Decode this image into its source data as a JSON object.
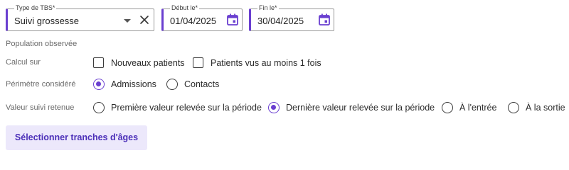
{
  "filters": {
    "type_tbs": {
      "label": "Type de TBS",
      "required_mark": "*",
      "value": "Suivi grossesse"
    },
    "debut": {
      "label": "Début le",
      "required_mark": "*",
      "value": "01/04/2025"
    },
    "fin": {
      "label": "Fin le",
      "required_mark": "*",
      "value": "30/04/2025"
    }
  },
  "section_title": "Population observée",
  "calcul_sur": {
    "label": "Calcul sur",
    "options": [
      {
        "label": "Nouveaux patients",
        "checked": false
      },
      {
        "label": "Patients vus au moins 1 fois",
        "checked": false
      }
    ]
  },
  "perimetre": {
    "label": "Périmètre considéré",
    "options": [
      {
        "label": "Admissions",
        "selected": true
      },
      {
        "label": "Contacts",
        "selected": false
      }
    ]
  },
  "valeur_suivi": {
    "label": "Valeur suivi retenue",
    "options": [
      {
        "label": "Première valeur relevée sur la période",
        "selected": false
      },
      {
        "label": "Dernière valeur relevée sur la période",
        "selected": true
      },
      {
        "label": "À l'entrée",
        "selected": false
      },
      {
        "label": "À la sortie",
        "selected": false
      }
    ]
  },
  "button": {
    "label": "Sélectionner tranches d'âges"
  },
  "colors": {
    "accent": "#6a3fd0",
    "button_bg": "#ece8fb",
    "button_text": "#4b2fb8"
  }
}
